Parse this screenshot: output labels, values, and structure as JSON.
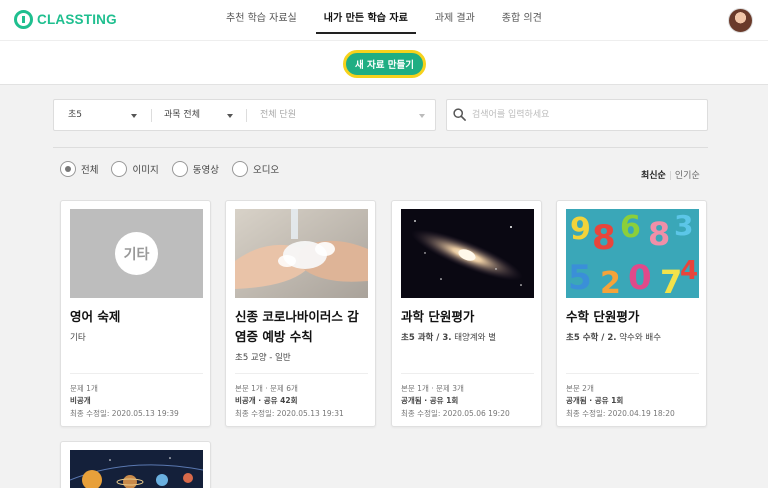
{
  "brand": {
    "name": "CLASSTING",
    "accent": "#1fbf8f"
  },
  "nav": [
    {
      "label": "추천 학습 자료실",
      "active": false
    },
    {
      "label": "내가 만든 학습 자료",
      "active": true
    },
    {
      "label": "과제 결과",
      "active": false
    },
    {
      "label": "종합 의견",
      "active": false
    }
  ],
  "new_button": "새 자료 만들기",
  "filters": {
    "grade": "초5",
    "subject": "과목 전체",
    "unit": "전체 단원"
  },
  "search": {
    "placeholder": "검색어를 입력하세요",
    "value": ""
  },
  "types": [
    {
      "label": "전체",
      "checked": true
    },
    {
      "label": "이미지",
      "checked": false
    },
    {
      "label": "동영상",
      "checked": false
    },
    {
      "label": "오디오",
      "checked": false
    }
  ],
  "sort": {
    "latest": "최신순",
    "divider": "|",
    "popular": "인기순"
  },
  "cards": [
    {
      "title": "영어 숙제",
      "subtitle": "기타",
      "thumb_label": "기타",
      "meta1": "문제 1개",
      "meta2": "비공개",
      "meta3": "최종 수정일: 2020.05.13 19:39"
    },
    {
      "title": "신종 코로나바이러스 감염증 예방 수칙",
      "subtitle": "초5 교양 - 일반",
      "meta1": "본문 1개 · 문제 6개",
      "meta2": "비공개 · 공유 42회",
      "meta3": "최종 수정일: 2020.05.13 19:31"
    },
    {
      "title": "과학 단원평가",
      "subtitle_bold": "초5 과학 / 3.",
      "subtitle_rest": " 태양계와 별",
      "meta1": "본문 1개 · 문제 3개",
      "meta2": "공개됨 · 공유 1회",
      "meta3": "최종 수정일: 2020.05.06 19:20"
    },
    {
      "title": "수학 단원평가",
      "subtitle_bold": "초5 수학 / 2.",
      "subtitle_rest": " 약수와 배수",
      "meta1": "본문 2개",
      "meta2": "공개됨 · 공유 1회",
      "meta3": "최종 수정일: 2020.04.19 18:20"
    }
  ],
  "icons": [
    "classting-logo-icon",
    "search-icon",
    "chevron-down-icon",
    "avatar"
  ]
}
